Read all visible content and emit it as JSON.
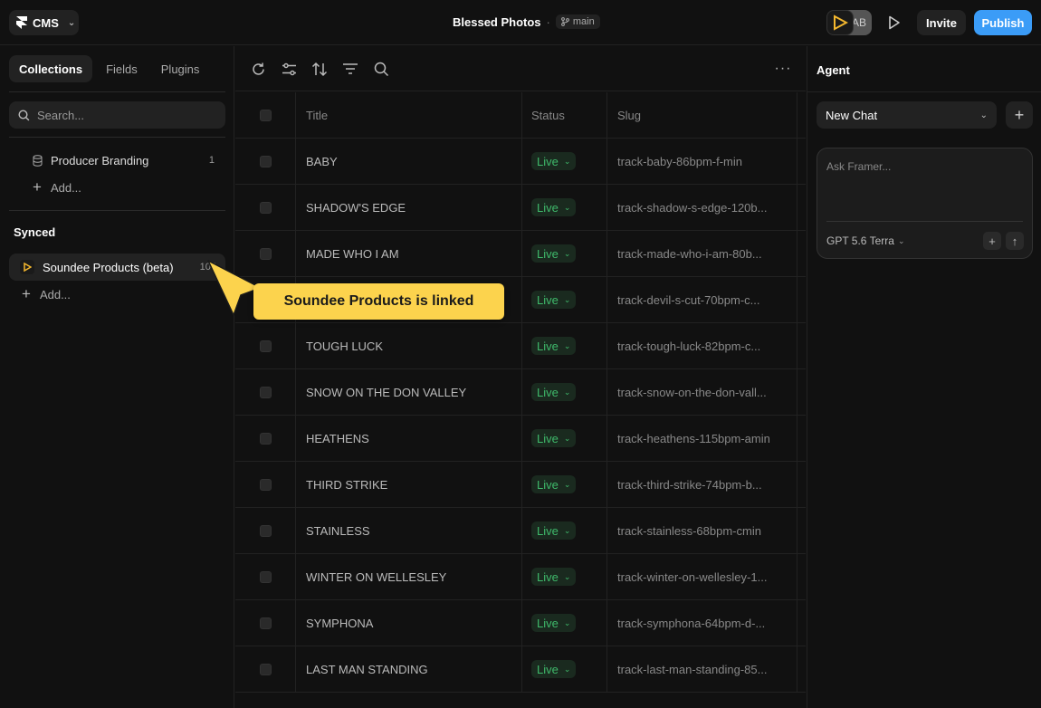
{
  "topbar": {
    "app_label": "CMS",
    "project_title": "Blessed Photos",
    "separator": "·",
    "branch": "main",
    "avatar_initials": "AB",
    "invite_label": "Invite",
    "publish_label": "Publish",
    "publish_color": "#3b9cf7"
  },
  "sidebar": {
    "tabs": [
      "Collections",
      "Fields",
      "Plugins"
    ],
    "search_placeholder": "Search...",
    "collections": [
      {
        "label": "Producer Branding",
        "count": "1"
      }
    ],
    "add_label": "Add...",
    "synced_heading": "Synced",
    "synced_items": [
      {
        "label": "Soundee Products (beta)",
        "count": "104"
      }
    ],
    "synced_add_label": "Add..."
  },
  "table": {
    "columns": [
      "Title",
      "Status",
      "Slug"
    ],
    "status_color": "#3fba6b",
    "rows": [
      {
        "title": "BABY",
        "status": "Live",
        "slug": "track-baby-86bpm-f-min"
      },
      {
        "title": "SHADOW'S EDGE",
        "status": "Live",
        "slug": "track-shadow-s-edge-120b..."
      },
      {
        "title": "MADE WHO I AM",
        "status": "Live",
        "slug": "track-made-who-i-am-80b..."
      },
      {
        "title": "",
        "status": "Live",
        "slug": "track-devil-s-cut-70bpm-c..."
      },
      {
        "title": "TOUGH LUCK",
        "status": "Live",
        "slug": "track-tough-luck-82bpm-c..."
      },
      {
        "title": "SNOW ON THE DON VALLEY",
        "status": "Live",
        "slug": "track-snow-on-the-don-vall..."
      },
      {
        "title": "HEATHENS",
        "status": "Live",
        "slug": "track-heathens-115bpm-amin"
      },
      {
        "title": "THIRD STRIKE",
        "status": "Live",
        "slug": "track-third-strike-74bpm-b..."
      },
      {
        "title": "STAINLESS",
        "status": "Live",
        "slug": "track-stainless-68bpm-cmin"
      },
      {
        "title": "WINTER ON WELLESLEY",
        "status": "Live",
        "slug": "track-winter-on-wellesley-1..."
      },
      {
        "title": "SYMPHONA",
        "status": "Live",
        "slug": "track-symphona-64bpm-d-..."
      },
      {
        "title": "LAST MAN STANDING",
        "status": "Live",
        "slug": "track-last-man-standing-85..."
      }
    ]
  },
  "agent": {
    "heading": "Agent",
    "chat_select": "New Chat",
    "input_placeholder": "Ask Framer...",
    "model": "GPT 5.6 Terra"
  },
  "callout": {
    "text": "Soundee Products is linked",
    "color": "#fcd34d"
  }
}
